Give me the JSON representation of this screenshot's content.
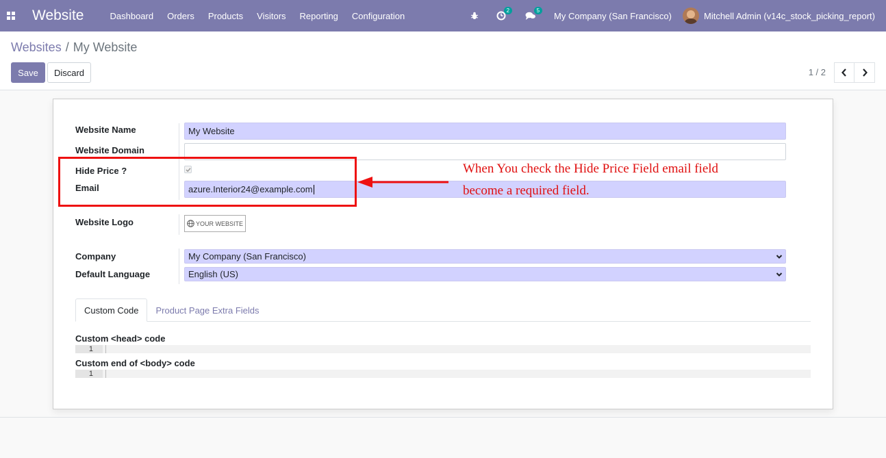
{
  "navbar": {
    "app_icon": "apps-grid-icon",
    "brand": "Website",
    "menu": [
      "Dashboard",
      "Orders",
      "Products",
      "Visitors",
      "Reporting",
      "Configuration"
    ],
    "activity_count": "2",
    "messages_count": "5",
    "company": "My Company (San Francisco)",
    "user": "Mitchell Admin (v14c_stock_picking_report)"
  },
  "breadcrumb": {
    "parent": "Websites",
    "separator": "/",
    "current": "My Website"
  },
  "buttons": {
    "save": "Save",
    "discard": "Discard"
  },
  "pager": {
    "value": "1 / 2"
  },
  "form": {
    "website_name_label": "Website Name",
    "website_name_value": "My Website",
    "website_domain_label": "Website Domain",
    "website_domain_value": "",
    "hide_price_label": "Hide Price ?",
    "hide_price_checked": true,
    "email_label": "Email",
    "email_value": "azure.Interior24@example.com",
    "website_logo_label": "Website Logo",
    "logo_text": "YOUR WEBSITE",
    "company_label": "Company",
    "company_value": "My Company (San Francisco)",
    "language_label": "Default Language",
    "language_value": "English (US)"
  },
  "annotation": {
    "line1": "When You check the Hide Price Field email field",
    "line2": "become a required field."
  },
  "tabs": [
    "Custom Code",
    "Product Page Extra Fields"
  ],
  "custom_code": {
    "head_label": "Custom <head> code",
    "body_label": "Custom end of <body> code",
    "line_number": "1"
  },
  "colors": {
    "navbar": "#7c7bad",
    "required_field": "#d2d2ff",
    "annotation": "#e01010"
  }
}
